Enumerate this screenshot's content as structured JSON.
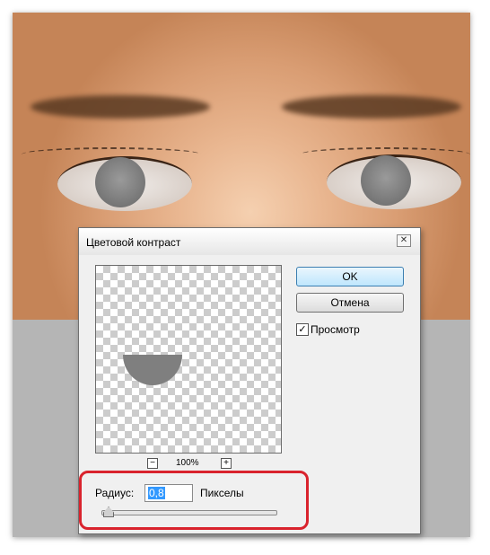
{
  "dialog": {
    "title": "Цветовой контраст",
    "close_glyph": "✕",
    "buttons": {
      "ok": "OK",
      "cancel": "Отмена"
    },
    "preview_checkbox": {
      "label": "Просмотр",
      "checked": true,
      "glyph": "✓"
    },
    "zoom": {
      "minus": "−",
      "plus": "+",
      "level": "100%"
    },
    "radius": {
      "label": "Радиус:",
      "value": "0,8",
      "unit": "Пикселы",
      "slider_fraction": 0.01
    },
    "highlight_color": "#d9232d"
  }
}
